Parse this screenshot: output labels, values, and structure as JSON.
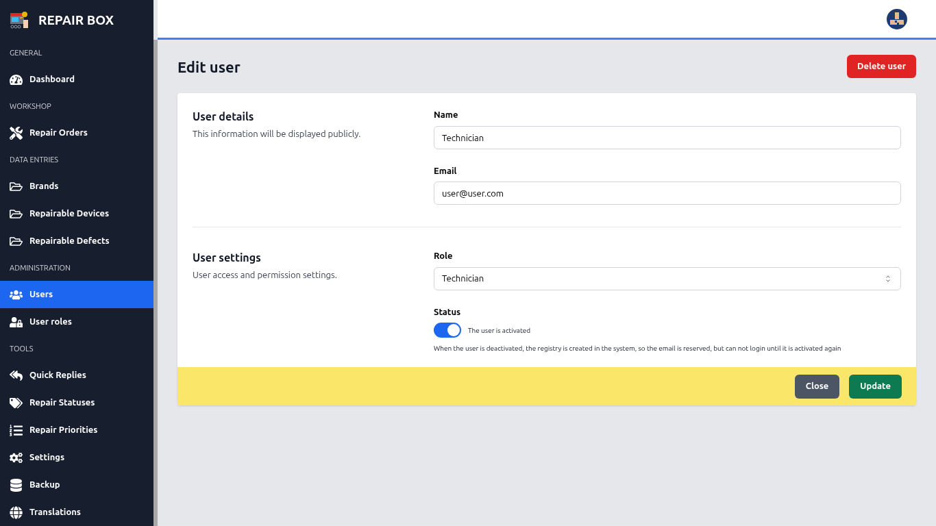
{
  "brand": {
    "name": "REPAIR BOX"
  },
  "sidebar": {
    "items": [
      {
        "kind": "section",
        "label": "GENERAL"
      },
      {
        "kind": "link",
        "label": "Dashboard",
        "selected": false
      },
      {
        "kind": "section",
        "label": "WORKSHOP"
      },
      {
        "kind": "link",
        "label": "Repair Orders",
        "selected": false
      },
      {
        "kind": "section",
        "label": "DATA ENTRIES"
      },
      {
        "kind": "link",
        "label": "Brands",
        "selected": false
      },
      {
        "kind": "link",
        "label": "Repairable Devices",
        "selected": false
      },
      {
        "kind": "link",
        "label": "Repairable Defects",
        "selected": false
      },
      {
        "kind": "section",
        "label": "ADMINISTRATION"
      },
      {
        "kind": "link",
        "label": "Users",
        "selected": true
      },
      {
        "kind": "link",
        "label": "User roles",
        "selected": false
      },
      {
        "kind": "section",
        "label": "TOOLS"
      },
      {
        "kind": "link",
        "label": "Quick Replies",
        "selected": false
      },
      {
        "kind": "link",
        "label": "Repair Statuses",
        "selected": false
      },
      {
        "kind": "link",
        "label": "Repair Priorities",
        "selected": false
      },
      {
        "kind": "link",
        "label": "Settings",
        "selected": false
      },
      {
        "kind": "link",
        "label": "Backup",
        "selected": false
      },
      {
        "kind": "link",
        "label": "Translations",
        "selected": false
      }
    ]
  },
  "page": {
    "title": "Edit user",
    "delete_button": "Delete user"
  },
  "user_details": {
    "title": "User details",
    "description": "This information will be displayed publicly.",
    "name": {
      "label": "Name",
      "value": "Technician"
    },
    "email": {
      "label": "Email",
      "value": "user@user.com"
    }
  },
  "user_settings": {
    "title": "User settings",
    "description": "User access and permission settings.",
    "role": {
      "label": "Role",
      "value": "Technician"
    },
    "status": {
      "label": "Status",
      "on": true,
      "toggle_label": "The user is activated",
      "help": "When the user is deactivated, the registry is created in the system, so the email is reserved, but can not login until it is activated again"
    }
  },
  "footer": {
    "buttons": [
      "Close",
      "Update"
    ]
  }
}
